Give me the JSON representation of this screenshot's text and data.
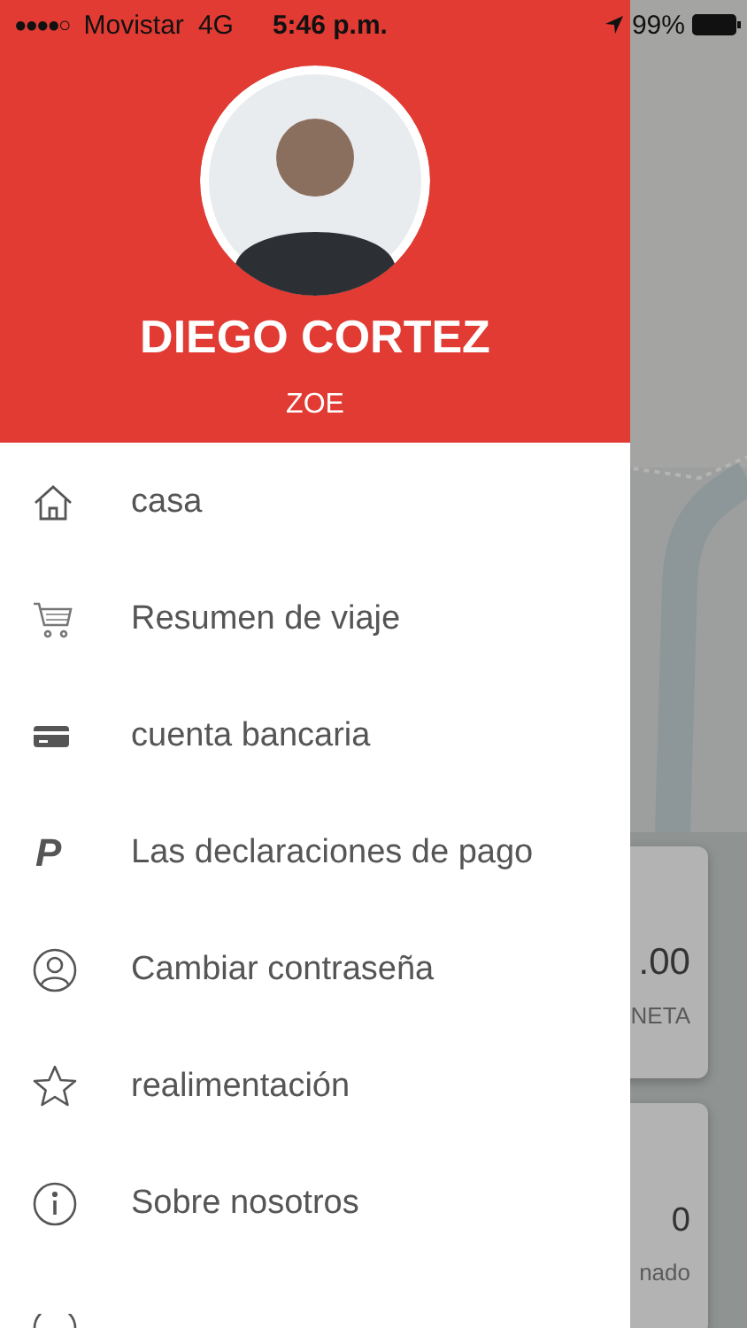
{
  "status_bar": {
    "signal": "●●●●○",
    "carrier": "Movistar",
    "network": "4G",
    "time": "5:46 p.m.",
    "battery": "99%"
  },
  "profile": {
    "name": "DIEGO CORTEZ",
    "subtitle": "ZOE"
  },
  "menu": [
    {
      "kind": "home",
      "label": "casa"
    },
    {
      "kind": "cart",
      "label": "Resumen de viaje"
    },
    {
      "kind": "card",
      "label": "cuenta bancaria"
    },
    {
      "kind": "glyph",
      "glyph": "P",
      "label": "Las declaraciones de pago"
    },
    {
      "kind": "user",
      "label": "Cambiar contraseña"
    },
    {
      "kind": "star",
      "label": "realimentación"
    },
    {
      "kind": "info",
      "label": "Sobre nosotros"
    }
  ],
  "background": {
    "cards": [
      {
        "value": ".00",
        "caption": "NETA"
      },
      {
        "value": "0",
        "caption": "nado"
      }
    ]
  }
}
